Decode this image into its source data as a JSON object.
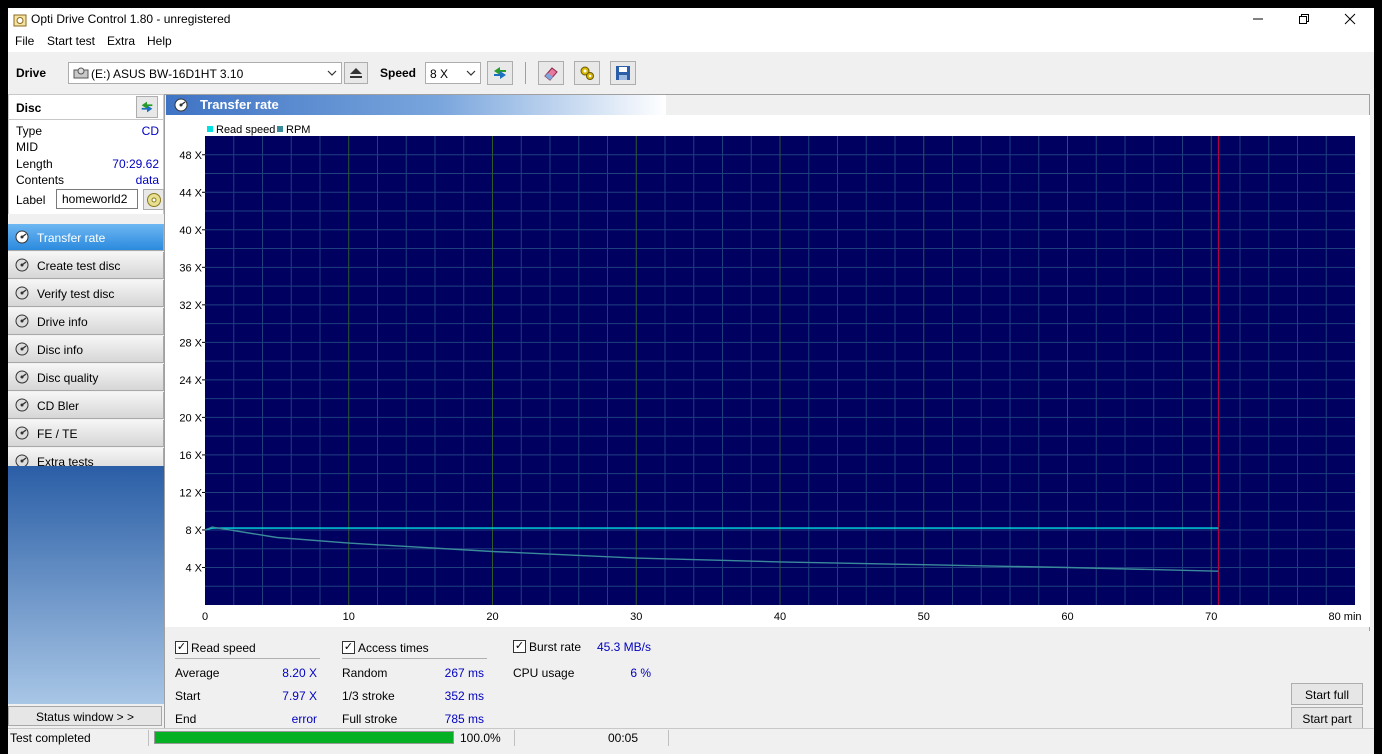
{
  "window": {
    "title": "Opti Drive Control 1.80 - unregistered"
  },
  "menu": [
    "File",
    "Start test",
    "Extra",
    "Help"
  ],
  "toolbar": {
    "drive_label": "Drive",
    "drive_value": "(E:)  ASUS BW-16D1HT 3.10",
    "speed_label": "Speed",
    "speed_value": "8 X"
  },
  "disc": {
    "header": "Disc",
    "type_label": "Type",
    "type_value": "CD",
    "mid_label": "MID",
    "mid_value": "",
    "length_label": "Length",
    "length_value": "70:29.62",
    "contents_label": "Contents",
    "contents_value": "data",
    "label_label": "Label",
    "label_value": "homeworld2"
  },
  "nav": [
    {
      "label": "Transfer rate",
      "active": true
    },
    {
      "label": "Create test disc"
    },
    {
      "label": "Verify test disc"
    },
    {
      "label": "Drive info"
    },
    {
      "label": "Disc info"
    },
    {
      "label": "Disc quality"
    },
    {
      "label": "CD Bler"
    },
    {
      "label": "FE / TE"
    },
    {
      "label": "Extra tests"
    }
  ],
  "status_window_label": "Status window > >",
  "panel_title": "Transfer rate",
  "chart_data": {
    "type": "line",
    "legend": [
      "Read speed",
      "RPM"
    ],
    "x_ticks": [
      "0",
      "10",
      "20",
      "30",
      "40",
      "50",
      "60",
      "70",
      "80 min"
    ],
    "y_ticks": [
      "4 X",
      "8 X",
      "12 X",
      "16 X",
      "20 X",
      "24 X",
      "28 X",
      "32 X",
      "36 X",
      "40 X",
      "44 X",
      "48 X"
    ],
    "xlim": [
      0,
      80
    ],
    "ylim": [
      0,
      50
    ],
    "marker_x": 70.5,
    "series": [
      {
        "name": "Read speed",
        "color": "#00e0e0",
        "x": [
          0,
          0.5,
          5,
          10,
          20,
          30,
          40,
          50,
          60,
          70.5
        ],
        "y": [
          8.0,
          8.2,
          8.2,
          8.2,
          8.2,
          8.2,
          8.2,
          8.2,
          8.2,
          8.2
        ]
      },
      {
        "name": "RPM",
        "color": "#3a8a9a",
        "x": [
          0,
          0.5,
          5,
          10,
          20,
          30,
          40,
          50,
          60,
          70.5
        ],
        "y": [
          8.0,
          8.3,
          7.2,
          6.6,
          5.7,
          5.0,
          4.6,
          4.3,
          4.0,
          3.6
        ]
      }
    ],
    "colors": {
      "plot_bg": "#000060",
      "grid_minor": "#1f3f7f",
      "grid_major": "#2e5a2e",
      "marker": "#c00040"
    }
  },
  "results": {
    "read_speed_label": "Read speed",
    "average_label": "Average",
    "average_value": "8.20 X",
    "start_label": "Start",
    "start_value": "7.97 X",
    "end_label": "End",
    "end_value": "error",
    "access_times_label": "Access times",
    "random_label": "Random",
    "random_value": "267 ms",
    "third_label": "1/3 stroke",
    "third_value": "352 ms",
    "full_label": "Full stroke",
    "full_value": "785 ms",
    "burst_label": "Burst rate",
    "burst_value": "45.3 MB/s",
    "cpu_label": "CPU usage",
    "cpu_value": "6 %",
    "start_full_label": "Start full",
    "start_part_label": "Start part"
  },
  "status": {
    "text": "Test completed",
    "progress": 1.0,
    "progress_text": "100.0%",
    "elapsed": "00:05"
  }
}
